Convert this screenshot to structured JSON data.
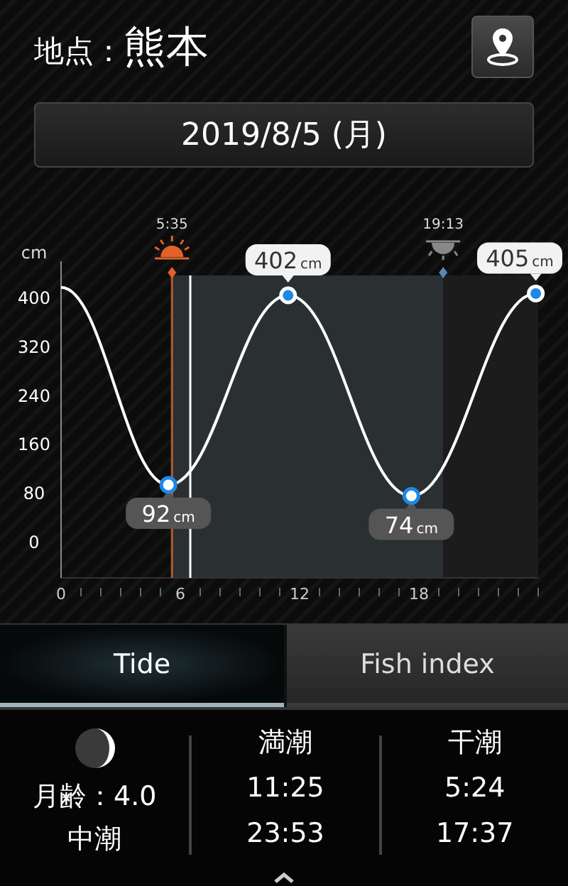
{
  "location": {
    "label": "地点：",
    "name": "熊本"
  },
  "date": "2019/8/5 (月)",
  "tide_chart": {
    "sunrise": {
      "time": "5:35"
    },
    "sunset": {
      "time": "19:13"
    },
    "extremes": [
      {
        "kind": "low",
        "value": "92",
        "unit": "cm"
      },
      {
        "kind": "high",
        "value": "402",
        "unit": "cm"
      },
      {
        "kind": "low",
        "value": "74",
        "unit": "cm"
      },
      {
        "kind": "high",
        "value": "405",
        "unit": "cm"
      }
    ],
    "chart_data": {
      "type": "line",
      "ylabel": "cm",
      "x": [
        0,
        5.4,
        11.42,
        17.62,
        23.88
      ],
      "series": [
        {
          "color": "#ffffff",
          "marker": "circle",
          "values": [
            415,
            92,
            402,
            74,
            405
          ]
        }
      ],
      "ref_lines": [
        {
          "axis": "x",
          "value": 5.58,
          "color": "#b55a2a"
        },
        {
          "axis": "x",
          "value": 6.5,
          "color": "#ffffff"
        }
      ],
      "bands": [
        {
          "axis": "x",
          "from": 5.58,
          "to": 19.22,
          "color": "#2a3032"
        },
        {
          "axis": "x",
          "from": 19.22,
          "to": 24,
          "color": "#1c1c1c"
        }
      ],
      "xlim": [
        0,
        24
      ],
      "ylim": [
        -60,
        460
      ],
      "xticks": [
        0,
        6,
        12,
        18
      ],
      "yticks": [
        0,
        80,
        160,
        240,
        320,
        400
      ]
    }
  },
  "tabs": [
    {
      "label": "Tide",
      "selected": true
    },
    {
      "label": "Fish index",
      "selected": false
    }
  ],
  "moon": {
    "age": "月齢：4.0",
    "tide_name": "中潮"
  },
  "high_tide": {
    "title": "満潮",
    "times": [
      "11:25",
      "23:53"
    ]
  },
  "low_tide": {
    "title": "干潮",
    "times": [
      "5:24",
      "17:37"
    ]
  }
}
